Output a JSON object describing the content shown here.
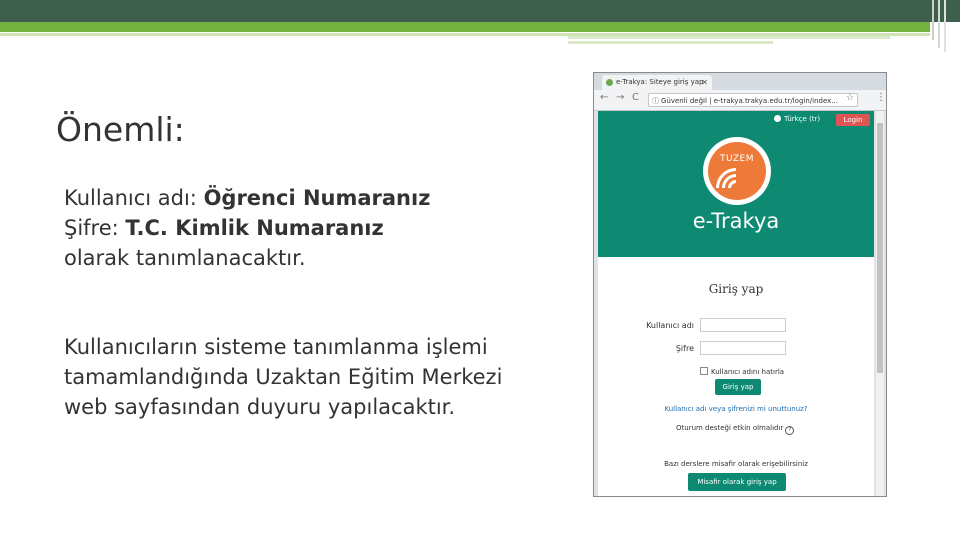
{
  "slide": {
    "title": "Önemli:",
    "para1": {
      "l1_a": "Kullanıcı adı: ",
      "l1_b": "Öğrenci Numaranız",
      "l2_a": "Şifre: ",
      "l2_b": "T.C. Kimlik Numaranız",
      "l3": "olarak tanımlanacaktır."
    },
    "para2": {
      "l1": "Kullanıcıların sisteme tanımlanma işlemi",
      "l2": "tamamlandığında Uzaktan Eğitim Merkezi",
      "l3": "web sayfasından duyuru yapılacaktır."
    }
  },
  "browser": {
    "tab_title": "e-Trakya: Siteye giriş yap",
    "tab_close": "✕",
    "nav": {
      "back": "←",
      "forward": "→",
      "reload": "C"
    },
    "address": "Güvenli değil  |  e-trakya.trakya.edu.tr/login/index...",
    "addr_info": "ⓘ",
    "star": "☆",
    "menu": "⋮"
  },
  "site": {
    "language": "Türkçe (tr)",
    "login_label": "Login",
    "logo_text": "TUZEM",
    "brand": "e-Trakya",
    "form_title": "Giriş yap",
    "username_label": "Kullanıcı adı",
    "password_label": "Şifre",
    "remember_label": "Kullanıcı adını hatırla",
    "submit_label": "Giriş yap",
    "forgot_link": "Kullanıcı adı veya şifrenizi mi unuttunuz?",
    "cookie_text": "Oturum desteği etkin olmalıdır",
    "q_icon": "?",
    "guest_text": "Bazı derslere misafir olarak erişebilirsiniz",
    "guest_button": "Misafir olarak giriş yap"
  },
  "colors": {
    "header_dark": "#3f5f4d",
    "accent_green": "#75b13f",
    "site_teal": "#0e8a73",
    "logo_orange": "#ee7a3a",
    "login_red": "#e05454"
  }
}
